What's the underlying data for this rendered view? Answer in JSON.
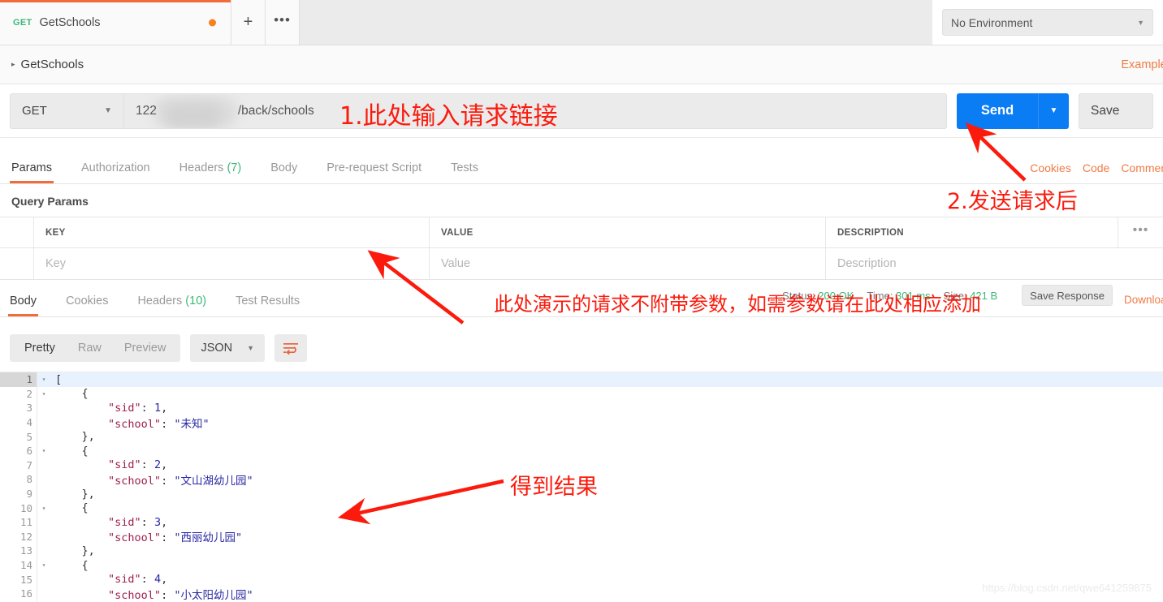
{
  "tabstrip": {
    "request_tab": {
      "method": "GET",
      "name": "GetSchools",
      "unsaved": true
    },
    "new_tab_label": "+",
    "more_label": "•••"
  },
  "environment": {
    "selected": "No Environment",
    "caret": "▼"
  },
  "breadcrumb": {
    "collapse_icon": "▸",
    "name": "GetSchools",
    "examples_link": "Examples"
  },
  "url_bar": {
    "method": "GET",
    "method_caret": "▼",
    "url_prefix": "122",
    "url_suffix": "/back/schools",
    "send_label": "Send",
    "send_caret": "▼",
    "save_label": "Save"
  },
  "request_tabs": {
    "items": [
      {
        "label": "Params",
        "active": true
      },
      {
        "label": "Authorization",
        "active": false
      },
      {
        "label": "Headers",
        "count": "(7)",
        "active": false
      },
      {
        "label": "Body",
        "active": false
      },
      {
        "label": "Pre-request Script",
        "active": false
      },
      {
        "label": "Tests",
        "active": false
      }
    ],
    "links": [
      "Cookies",
      "Code",
      "Comments"
    ]
  },
  "query_params": {
    "title": "Query Params",
    "columns": [
      "KEY",
      "VALUE",
      "DESCRIPTION"
    ],
    "more_icon": "•••",
    "rows": [
      {
        "key": "Key",
        "value": "Value",
        "description": "Description"
      }
    ]
  },
  "response": {
    "tabs": [
      {
        "label": "Body",
        "active": true
      },
      {
        "label": "Cookies",
        "active": false
      },
      {
        "label": "Headers",
        "count": "(10)",
        "active": false
      },
      {
        "label": "Test Results",
        "active": false
      }
    ],
    "status_label": "Status:",
    "status_value": "200 OK",
    "time_label": "Time:",
    "time_value": "301 ms",
    "size_label": "Size:",
    "size_value": "421 B",
    "save_response_label": "Save Response",
    "download_label": "Download",
    "format": {
      "modes": [
        {
          "label": "Pretty",
          "active": true
        },
        {
          "label": "Raw",
          "active": false
        },
        {
          "label": "Preview",
          "active": false
        }
      ],
      "language": "JSON",
      "language_caret": "▼",
      "wrap_icon": "word-wrap-icon"
    }
  },
  "body_json": {
    "lines": [
      {
        "no": "1",
        "fold": "▾",
        "indent": 0,
        "tokens": [
          {
            "t": "p",
            "v": "["
          }
        ]
      },
      {
        "no": "2",
        "fold": "▾",
        "indent": 1,
        "tokens": [
          {
            "t": "p",
            "v": "{"
          }
        ]
      },
      {
        "no": "3",
        "fold": "",
        "indent": 2,
        "tokens": [
          {
            "t": "k",
            "v": "\"sid\""
          },
          {
            "t": "p",
            "v": ": "
          },
          {
            "t": "n",
            "v": "1"
          },
          {
            "t": "p",
            "v": ","
          }
        ]
      },
      {
        "no": "4",
        "fold": "",
        "indent": 2,
        "tokens": [
          {
            "t": "k",
            "v": "\"school\""
          },
          {
            "t": "p",
            "v": ": "
          },
          {
            "t": "s",
            "v": "\"未知\""
          }
        ]
      },
      {
        "no": "5",
        "fold": "",
        "indent": 1,
        "tokens": [
          {
            "t": "p",
            "v": "},"
          }
        ]
      },
      {
        "no": "6",
        "fold": "▾",
        "indent": 1,
        "tokens": [
          {
            "t": "p",
            "v": "{"
          }
        ]
      },
      {
        "no": "7",
        "fold": "",
        "indent": 2,
        "tokens": [
          {
            "t": "k",
            "v": "\"sid\""
          },
          {
            "t": "p",
            "v": ": "
          },
          {
            "t": "n",
            "v": "2"
          },
          {
            "t": "p",
            "v": ","
          }
        ]
      },
      {
        "no": "8",
        "fold": "",
        "indent": 2,
        "tokens": [
          {
            "t": "k",
            "v": "\"school\""
          },
          {
            "t": "p",
            "v": ": "
          },
          {
            "t": "s",
            "v": "\"文山湖幼儿园\""
          }
        ]
      },
      {
        "no": "9",
        "fold": "",
        "indent": 1,
        "tokens": [
          {
            "t": "p",
            "v": "},"
          }
        ]
      },
      {
        "no": "10",
        "fold": "▾",
        "indent": 1,
        "tokens": [
          {
            "t": "p",
            "v": "{"
          }
        ]
      },
      {
        "no": "11",
        "fold": "",
        "indent": 2,
        "tokens": [
          {
            "t": "k",
            "v": "\"sid\""
          },
          {
            "t": "p",
            "v": ": "
          },
          {
            "t": "n",
            "v": "3"
          },
          {
            "t": "p",
            "v": ","
          }
        ]
      },
      {
        "no": "12",
        "fold": "",
        "indent": 2,
        "tokens": [
          {
            "t": "k",
            "v": "\"school\""
          },
          {
            "t": "p",
            "v": ": "
          },
          {
            "t": "s",
            "v": "\"西丽幼儿园\""
          }
        ]
      },
      {
        "no": "13",
        "fold": "",
        "indent": 1,
        "tokens": [
          {
            "t": "p",
            "v": "},"
          }
        ]
      },
      {
        "no": "14",
        "fold": "▾",
        "indent": 1,
        "tokens": [
          {
            "t": "p",
            "v": "{"
          }
        ]
      },
      {
        "no": "15",
        "fold": "",
        "indent": 2,
        "tokens": [
          {
            "t": "k",
            "v": "\"sid\""
          },
          {
            "t": "p",
            "v": ": "
          },
          {
            "t": "n",
            "v": "4"
          },
          {
            "t": "p",
            "v": ","
          }
        ]
      },
      {
        "no": "16",
        "fold": "",
        "indent": 2,
        "tokens": [
          {
            "t": "k",
            "v": "\"school\""
          },
          {
            "t": "p",
            "v": ": "
          },
          {
            "t": "s",
            "v": "\"小太阳幼儿园\""
          }
        ]
      }
    ],
    "parsed": [
      {
        "sid": 1,
        "school": "未知"
      },
      {
        "sid": 2,
        "school": "文山湖幼儿园"
      },
      {
        "sid": 3,
        "school": "西丽幼儿园"
      },
      {
        "sid": 4,
        "school": "小太阳幼儿园"
      }
    ]
  },
  "annotations": {
    "a1": "1.此处输入请求链接",
    "a2": "2.发送请求后",
    "a3": "此处演示的请求不附带参数，如需参数请在此处相应添加",
    "a4": "得到结果",
    "color": "#fb1b0d"
  },
  "watermark": "https://blog.csdn.net/qwe641259875"
}
